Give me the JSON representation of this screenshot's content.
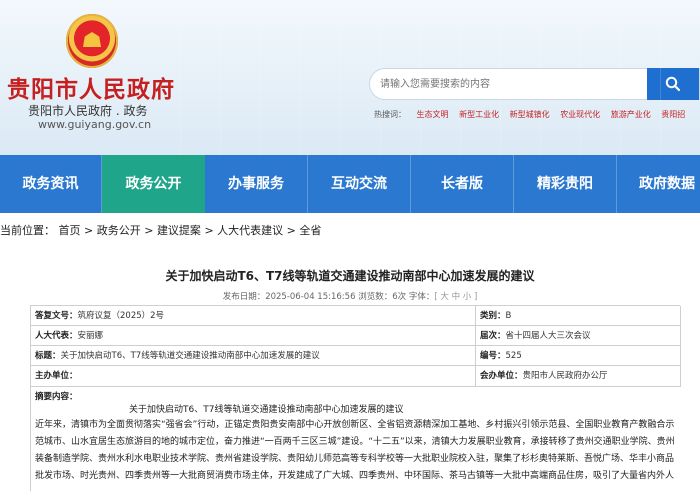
{
  "header": {
    "site_title": "贵阳市人民政府",
    "site_subtitle": "贵阳市人民政府 . 政务",
    "site_url": "www.guiyang.gov.cn",
    "search_placeholder": "请输入您需要搜索的内容",
    "hot_label": "热搜词：",
    "hot_items": [
      "生态文明",
      "新型工业化",
      "新型城镇化",
      "农业现代化",
      "旅游产业化",
      "贵阳招"
    ]
  },
  "nav": {
    "items": [
      "政务资讯",
      "政务公开",
      "办事服务",
      "互动交流",
      "长者版",
      "精彩贵阳",
      "政府数据"
    ],
    "active_index": 1
  },
  "breadcrumb": {
    "label": "当前位置：",
    "items": [
      "首页",
      ">",
      "政务公开",
      ">",
      "建议提案",
      ">",
      "人大代表建议",
      ">",
      "全省"
    ]
  },
  "content": {
    "title": "关于加快启动T6、T7线等轨道交通建设推动南部中心加速发展的建议",
    "published_label": "发布日期：",
    "published": "2025-06-04 15:16:56",
    "views_label": "浏览数：",
    "views": "6次",
    "font_size_label": "字体：",
    "font_size_options": "[ 大  中  小 ]"
  },
  "table": {
    "rows": [
      {
        "label": "答复文号：",
        "value": "筑府议复（2025）2号",
        "label2": "类别：",
        "value2": "B"
      },
      {
        "label": "人大代表：",
        "value": "安丽娜",
        "label2": "届次：",
        "value2": "省十四届人大三次会议"
      },
      {
        "label": "标题：",
        "value": "关于加快启动T6、T7线等轨道交通建设推动南部中心加速发展的建议",
        "label2": "编号：",
        "value2": "525"
      },
      {
        "label": "主办单位：",
        "value": "",
        "label2": "会办单位：",
        "value2": "贵阳市人民政府办公厅"
      }
    ],
    "abstract_label": "摘要内容：",
    "abstract_title": "关于加快启动T6、T7线等轨道交通建设推动南部中心加速发展的建议",
    "abstract_text": "近年来，清镇市为全面贯彻落实“强省会”行动，正锚定贵阳贵安南部中心开放创新区、全省铝资源精深加工基地、乡村振兴引领示范县、全国职业教育产教融合示范城市、山水宜居生态旅游目的地的城市定位，奋力推进“一百两千三区三城”建设。“十二五”以来，清镇大力发展职业教育，承接转移了贵州交通职业学院、贵州装备制造学院、贵州水利水电职业技术学院、贵州省建设学院、贵阳幼儿师范高等专科学校等一大批职业院校入驻，聚集了杉杉奥特莱斯、吾悦广场、华丰小商品批发市场、时光贵州、四季贵州等一大批商贸消费市场主体，开发建成了广大城、四季贵州、中环国际、茶马古镇等一大批中高端商品住房，吸引了大量省内外人"
  }
}
